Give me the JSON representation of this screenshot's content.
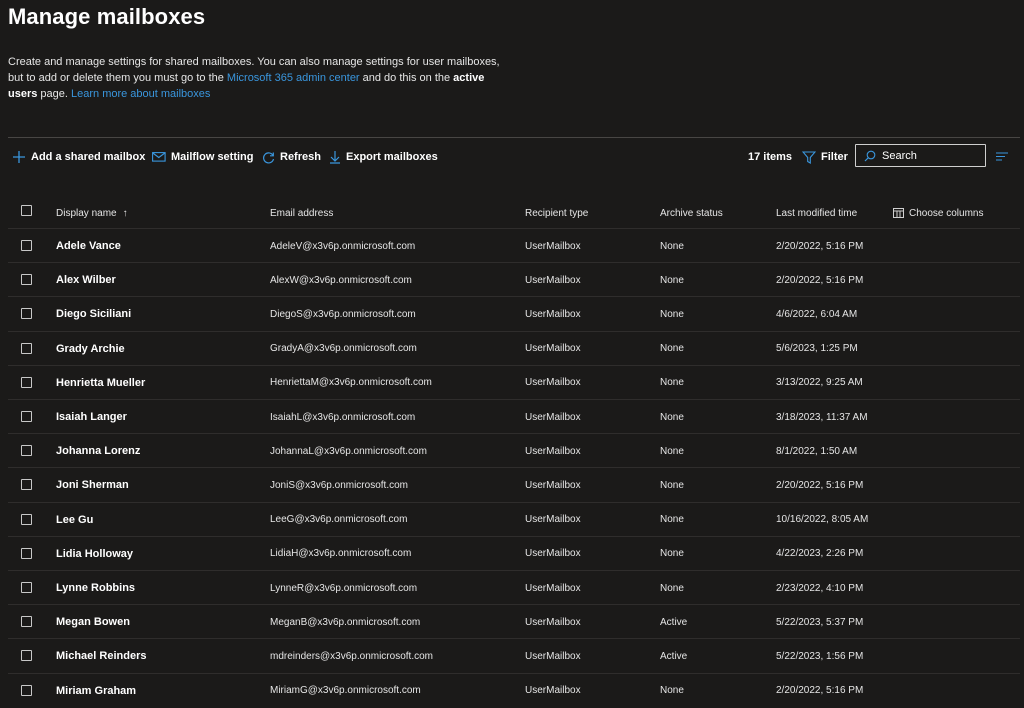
{
  "header": {
    "title": "Manage mailboxes",
    "desc_part1": "Create and manage settings for shared mailboxes. You can also manage settings for user mailboxes, but to add or delete them you must go to the ",
    "admin_link": "Microsoft 365 admin center",
    "desc_part2": " and do this on the ",
    "active_users": "active users",
    "desc_part3": " page. ",
    "learn_link": "Learn more about mailboxes"
  },
  "toolbar": {
    "add_shared": "Add a shared mailbox",
    "mailflow": "Mailflow setting",
    "refresh": "Refresh",
    "export": "Export mailboxes",
    "count": "17 items",
    "filter": "Filter",
    "search_placeholder": "Search"
  },
  "columns": {
    "display_name": "Display name",
    "sort_arrow": "↑",
    "email": "Email address",
    "recipient_type": "Recipient type",
    "archive_status": "Archive status",
    "last_modified": "Last modified time",
    "choose_columns": "Choose columns"
  },
  "rows": [
    {
      "name": "Adele Vance",
      "email": "AdeleV@x3v6p.onmicrosoft.com",
      "type": "UserMailbox",
      "archive": "None",
      "modified": "2/20/2022, 5:16 PM"
    },
    {
      "name": "Alex Wilber",
      "email": "AlexW@x3v6p.onmicrosoft.com",
      "type": "UserMailbox",
      "archive": "None",
      "modified": "2/20/2022, 5:16 PM"
    },
    {
      "name": "Diego Siciliani",
      "email": "DiegoS@x3v6p.onmicrosoft.com",
      "type": "UserMailbox",
      "archive": "None",
      "modified": "4/6/2022, 6:04 AM"
    },
    {
      "name": "Grady Archie",
      "email": "GradyA@x3v6p.onmicrosoft.com",
      "type": "UserMailbox",
      "archive": "None",
      "modified": "5/6/2023, 1:25 PM"
    },
    {
      "name": "Henrietta Mueller",
      "email": "HenriettaM@x3v6p.onmicrosoft.com",
      "type": "UserMailbox",
      "archive": "None",
      "modified": "3/13/2022, 9:25 AM"
    },
    {
      "name": "Isaiah Langer",
      "email": "IsaiahL@x3v6p.onmicrosoft.com",
      "type": "UserMailbox",
      "archive": "None",
      "modified": "3/18/2023, 11:37 AM"
    },
    {
      "name": "Johanna Lorenz",
      "email": "JohannaL@x3v6p.onmicrosoft.com",
      "type": "UserMailbox",
      "archive": "None",
      "modified": "8/1/2022, 1:50 AM"
    },
    {
      "name": "Joni Sherman",
      "email": "JoniS@x3v6p.onmicrosoft.com",
      "type": "UserMailbox",
      "archive": "None",
      "modified": "2/20/2022, 5:16 PM"
    },
    {
      "name": "Lee Gu",
      "email": "LeeG@x3v6p.onmicrosoft.com",
      "type": "UserMailbox",
      "archive": "None",
      "modified": "10/16/2022, 8:05 AM"
    },
    {
      "name": "Lidia Holloway",
      "email": "LidiaH@x3v6p.onmicrosoft.com",
      "type": "UserMailbox",
      "archive": "None",
      "modified": "4/22/2023, 2:26 PM"
    },
    {
      "name": "Lynne Robbins",
      "email": "LynneR@x3v6p.onmicrosoft.com",
      "type": "UserMailbox",
      "archive": "None",
      "modified": "2/23/2022, 4:10 PM"
    },
    {
      "name": "Megan Bowen",
      "email": "MeganB@x3v6p.onmicrosoft.com",
      "type": "UserMailbox",
      "archive": "Active",
      "modified": "5/22/2023, 5:37 PM"
    },
    {
      "name": "Michael Reinders",
      "email": "mdreinders@x3v6p.onmicrosoft.com",
      "type": "UserMailbox",
      "archive": "Active",
      "modified": "5/22/2023, 1:56 PM"
    },
    {
      "name": "Miriam Graham",
      "email": "MiriamG@x3v6p.onmicrosoft.com",
      "type": "UserMailbox",
      "archive": "None",
      "modified": "2/20/2022, 5:16 PM"
    }
  ],
  "colors": {
    "accent": "#3a96dd",
    "background": "#1b1a19"
  }
}
